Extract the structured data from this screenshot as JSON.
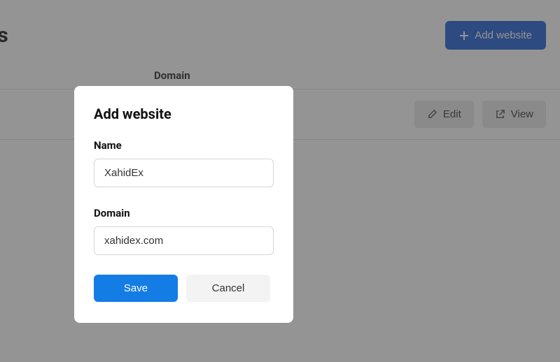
{
  "page": {
    "title_fragment": "tes",
    "add_website_button": "Add website",
    "table": {
      "columns": {
        "domain": "Domain"
      },
      "row_actions": {
        "edit": "Edit",
        "view": "View"
      }
    }
  },
  "modal": {
    "title": "Add website",
    "fields": {
      "name": {
        "label": "Name",
        "value": "XahidEx"
      },
      "domain": {
        "label": "Domain",
        "value": "xahidex.com"
      }
    },
    "actions": {
      "save": "Save",
      "cancel": "Cancel"
    }
  }
}
